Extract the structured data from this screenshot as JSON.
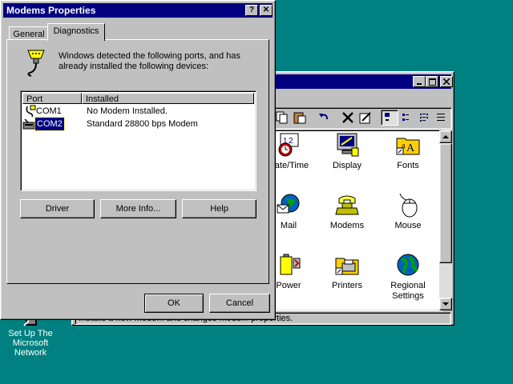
{
  "desktop": {
    "msn_label": "Set Up The Microsoft Network"
  },
  "control_panel": {
    "status_text": "Installs a new modem and changes modem properties.",
    "items": [
      {
        "label": "Date/Time",
        "icon": "clock-calendar-icon"
      },
      {
        "label": "Display",
        "icon": "display-icon"
      },
      {
        "label": "Fonts",
        "icon": "fonts-folder-icon"
      },
      {
        "label": "Mail",
        "icon": "mail-globe-icon"
      },
      {
        "label": "Modems",
        "icon": "modem-phone-icon"
      },
      {
        "label": "Mouse",
        "icon": "mouse-icon"
      },
      {
        "label": "Power",
        "icon": "power-battery-icon"
      },
      {
        "label": "Printers",
        "icon": "printers-folder-icon"
      },
      {
        "label": "Regional Settings",
        "icon": "regional-globe-icon"
      }
    ]
  },
  "dialog": {
    "title": "Modems Properties",
    "help_glyph": "?",
    "close_glyph": "✕",
    "tabs": [
      {
        "label": "General",
        "active": false
      },
      {
        "label": "Diagnostics",
        "active": true
      }
    ],
    "description": "Windows detected the following ports, and has already installed the following devices:",
    "columns": {
      "port": "Port",
      "installed": "Installed"
    },
    "rows": [
      {
        "port": "COM1",
        "installed": "No Modem Installed.",
        "selected": false
      },
      {
        "port": "COM2",
        "installed": "Standard 28800 bps Modem",
        "selected": true
      }
    ],
    "buttons": {
      "driver": "Driver",
      "more_info": "More Info...",
      "help": "Help",
      "ok": "OK",
      "cancel": "Cancel"
    }
  },
  "colors": {
    "desktop": "#008080",
    "face": "#c0c0c0",
    "title_active": "#000080",
    "selection": "#000080"
  }
}
